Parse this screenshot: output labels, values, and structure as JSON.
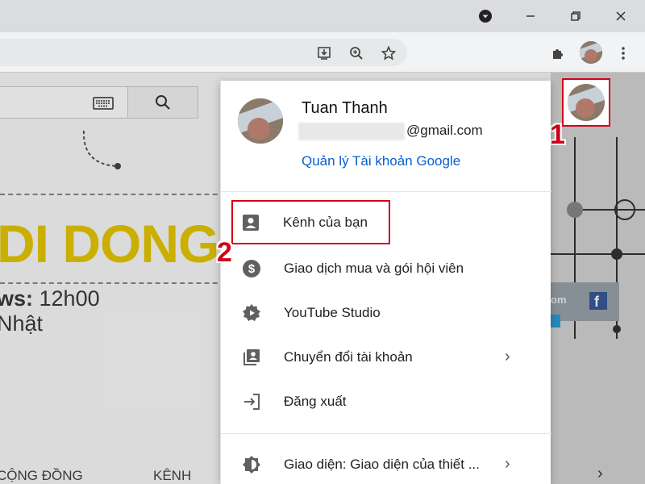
{
  "browser": {
    "window_controls": [
      "minimize",
      "restore",
      "close"
    ]
  },
  "page": {
    "banner_text": "DI DONG",
    "news_line_1_prefix": "ws:",
    "news_line_1_time": " 12h00",
    "news_line_2": "Nhật",
    "bottom_tabs": [
      "CỘNG ĐỒNG",
      "KÊNH"
    ],
    "art_partial_text": "om"
  },
  "account_menu": {
    "user_name": "Tuan Thanh",
    "email_domain": "@gmail.com",
    "manage_link": "Quản lý Tài khoản Google",
    "items": [
      {
        "label": "Kênh của bạn",
        "icon": "person-box-icon",
        "has_arrow": false
      },
      {
        "label": "Giao dịch mua và gói hội viên",
        "icon": "dollar-icon",
        "has_arrow": false
      },
      {
        "label": "YouTube Studio",
        "icon": "studio-gear-icon",
        "has_arrow": false
      },
      {
        "label": "Chuyển đổi tài khoản",
        "icon": "switch-account-icon",
        "has_arrow": true
      },
      {
        "label": "Đăng xuất",
        "icon": "sign-out-icon",
        "has_arrow": false
      },
      {
        "label": "Giao diện: Giao diện của thiết ...",
        "icon": "theme-icon",
        "has_arrow": true
      }
    ]
  },
  "annotations": {
    "step_1": "1",
    "step_2": "2",
    "highlight_color": "#d0021b"
  },
  "colors": {
    "link_blue": "#065fd4",
    "banner_yellow": "#e6c800"
  }
}
